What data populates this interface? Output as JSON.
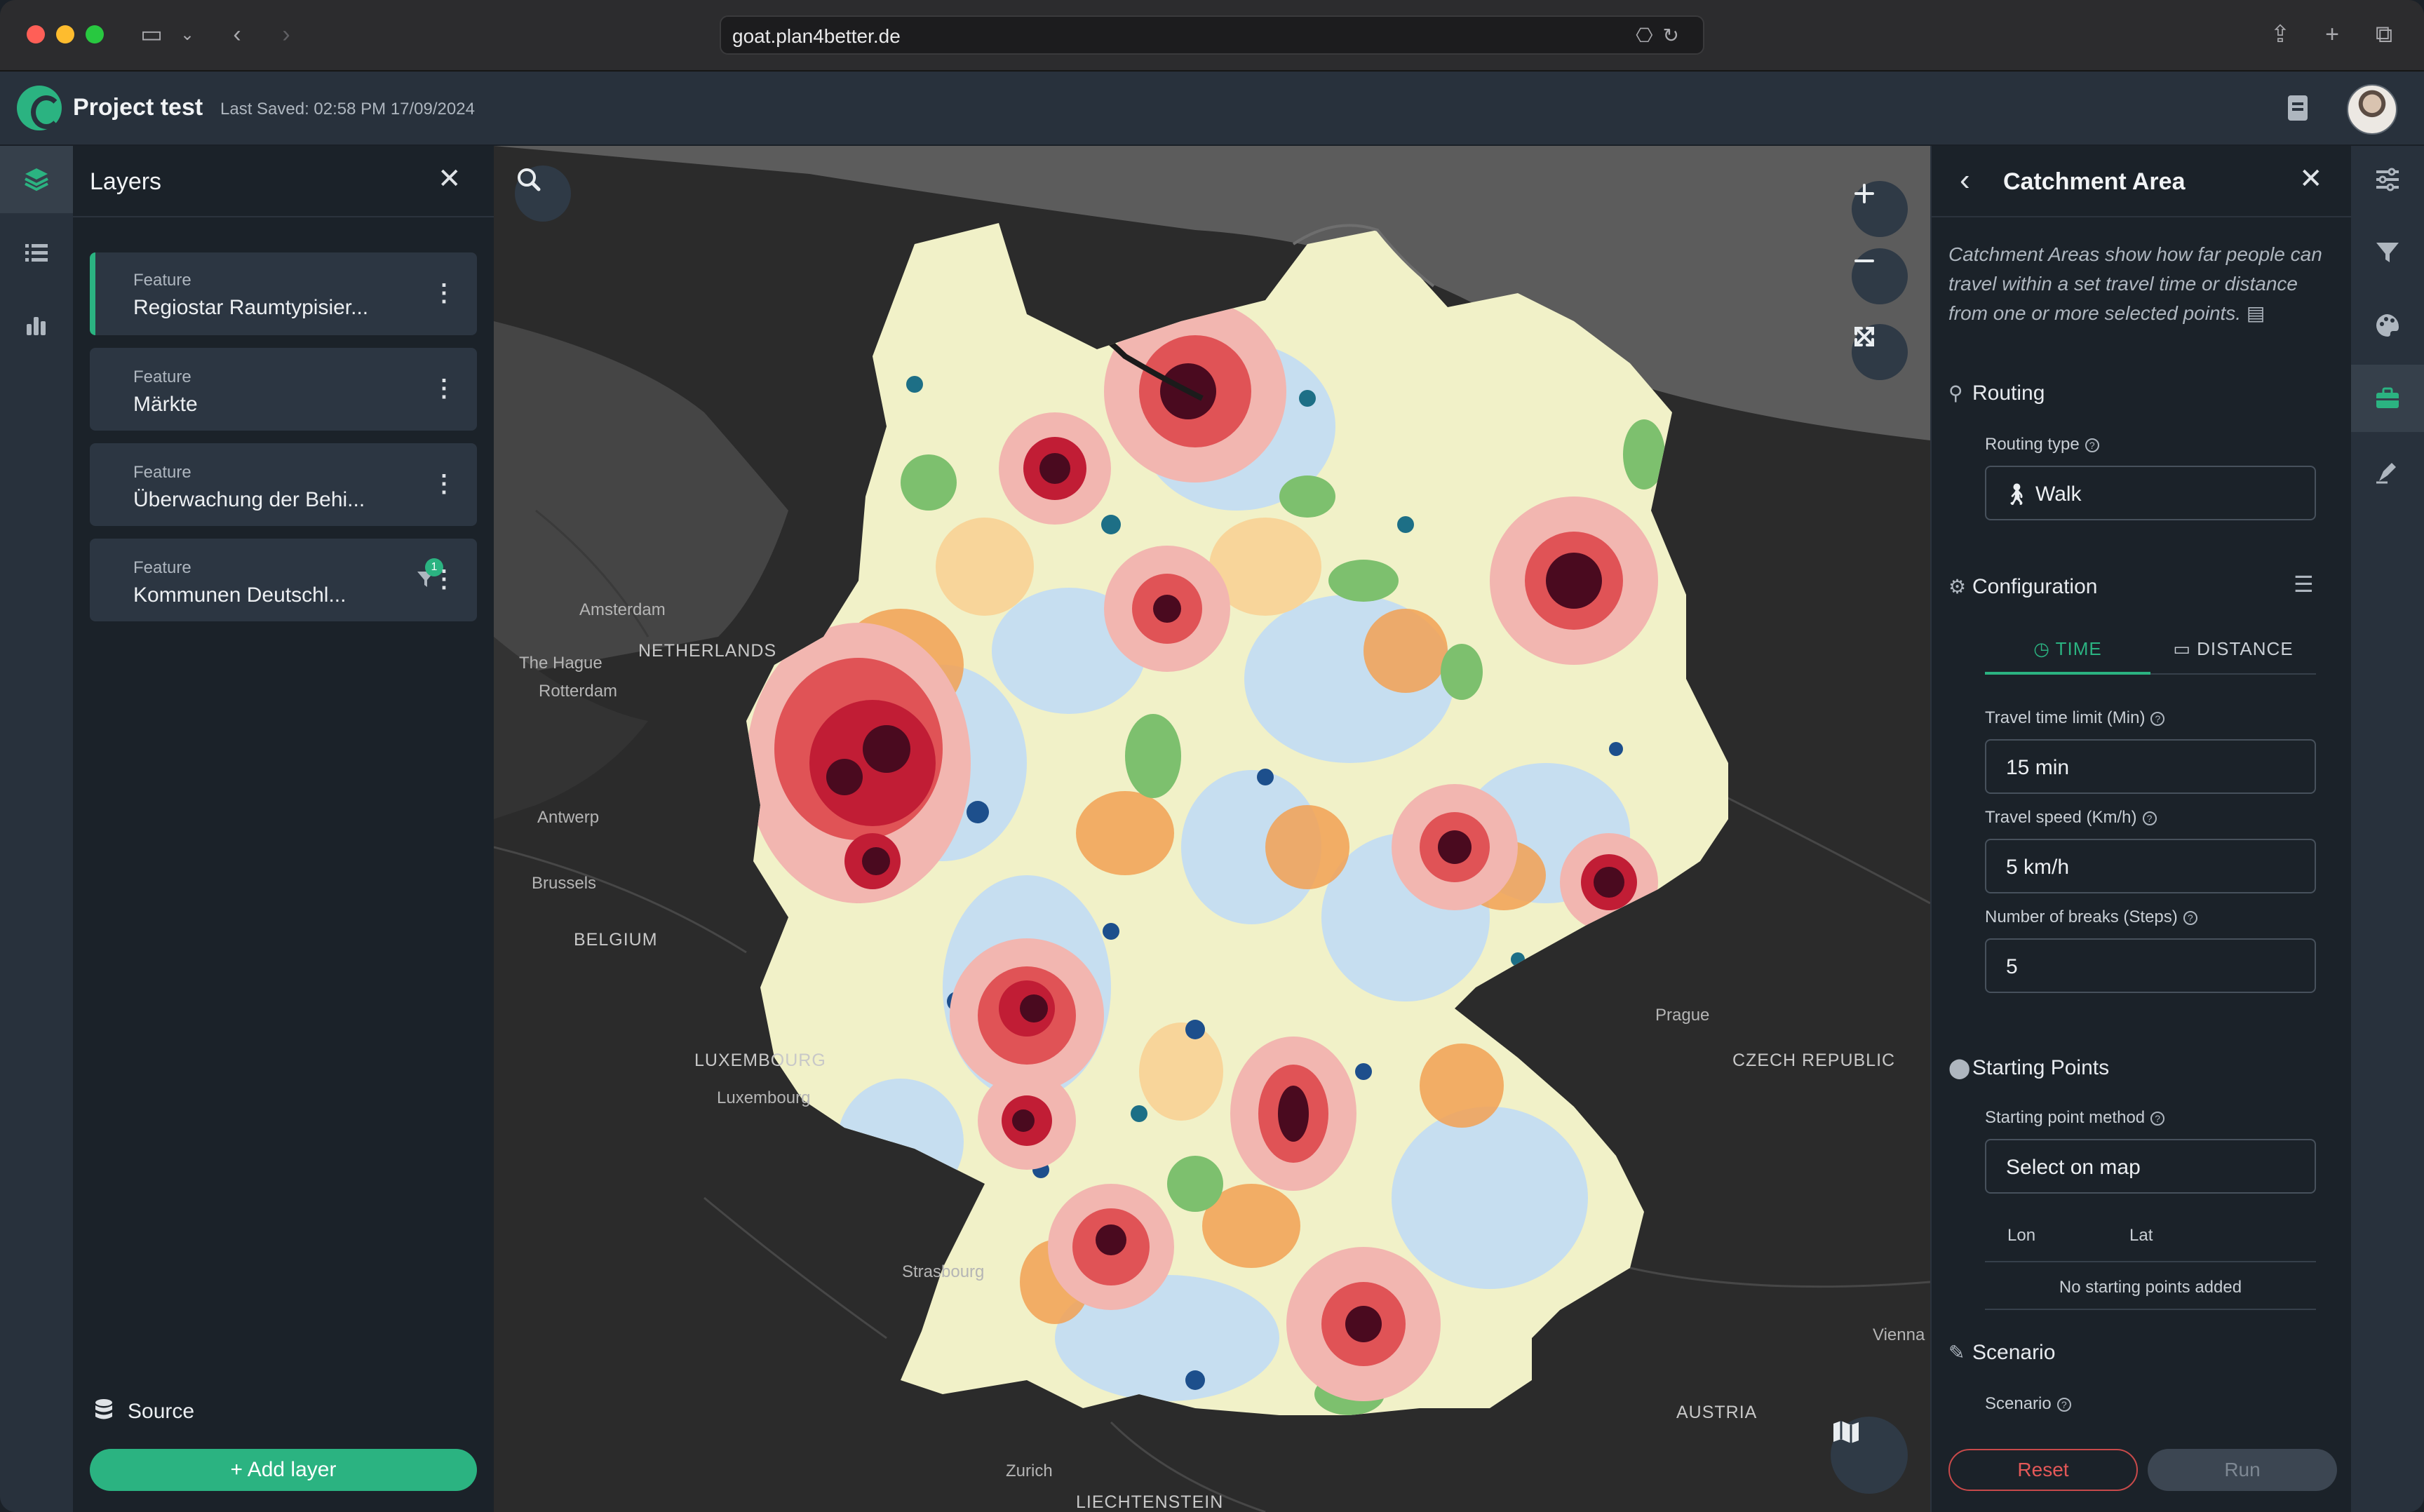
{
  "browser": {
    "url": "goat.plan4better.de"
  },
  "header": {
    "project_title": "Project test",
    "last_saved": "Last Saved: 02:58 PM 17/09/2024"
  },
  "layers_panel": {
    "title": "Layers",
    "layers": [
      {
        "type": "Feature",
        "name": "Regiostar Raumtypisier..."
      },
      {
        "type": "Feature",
        "name": "Märkte"
      },
      {
        "type": "Feature",
        "name": "Überwachung der Behi..."
      },
      {
        "type": "Feature",
        "name": "Kommunen Deutschl...",
        "filter_count": "1"
      }
    ],
    "source_label": "Source",
    "add_layer_label": "Add layer"
  },
  "map": {
    "labels": {
      "amsterdam": "Amsterdam",
      "the_hague": "The Hague",
      "netherlands": "NETHERLANDS",
      "rotterdam": "Rotterdam",
      "antwerp": "Antwerp",
      "brussels": "Brussels",
      "belgium": "BELGIUM",
      "luxembourg_country": "LUXEMBOURG",
      "luxembourg_city": "Luxembourg",
      "strasbourg": "Strasbourg",
      "zurich": "Zurich",
      "liechtenstein": "LIECHTENSTEIN",
      "prague": "Prague",
      "czech_republic": "CZECH REPUBLIC",
      "vienna": "Vienna",
      "austria": "AUSTRIA"
    },
    "colors": {
      "land": "#f1f1c8",
      "light_blue": "#c6def0",
      "blue": "#4f8fd0",
      "dark_blue": "#1d4f8c",
      "teal": "#1d6f86",
      "green": "#7dc06e",
      "light_green": "#b5d88b",
      "orange": "#f2a154",
      "pale_orange": "#f8d59a",
      "pink": "#f2b6b0",
      "red": "#e05356",
      "crimson": "#c11d35",
      "dark_red": "#4a0a1f"
    }
  },
  "tool_panel": {
    "title": "Catchment Area",
    "description": "Catchment Areas show how far people can travel within a set travel time or distance from one or more selected points.",
    "routing": {
      "heading": "Routing",
      "type_label": "Routing type",
      "type_value": "Walk"
    },
    "configuration": {
      "heading": "Configuration",
      "tabs": [
        "TIME",
        "DISTANCE"
      ],
      "time_limit_label": "Travel time limit (Min)",
      "time_limit_value": "15 min",
      "speed_label": "Travel speed (Km/h)",
      "speed_value": "5 km/h",
      "breaks_label": "Number of breaks (Steps)",
      "breaks_value": "5"
    },
    "starting_points": {
      "heading": "Starting Points",
      "method_label": "Starting point method",
      "method_value": "Select on map",
      "col_lon": "Lon",
      "col_lat": "Lat",
      "empty_message": "No starting points added"
    },
    "scenario": {
      "heading": "Scenario",
      "label": "Scenario"
    },
    "reset_label": "Reset",
    "run_label": "Run"
  }
}
